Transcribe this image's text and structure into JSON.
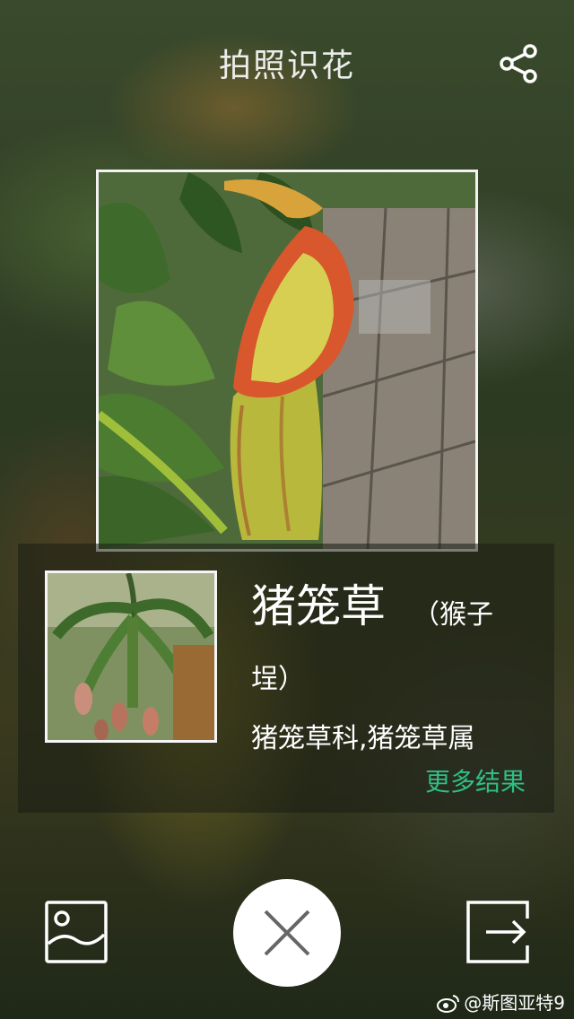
{
  "header": {
    "title": "拍照识花"
  },
  "result": {
    "name": "猪笼草",
    "alias_line1": "（猴子",
    "alias_line2": "埕）",
    "taxonomy": "猪笼草科,猪笼草属",
    "more_results_label": "更多结果"
  },
  "watermark": {
    "text": "@斯图亚特9"
  },
  "icons": {
    "share": "share-icon",
    "gallery": "image-gallery-icon",
    "close": "close-icon",
    "exit": "exit-icon",
    "weibo": "weibo-icon"
  },
  "colors": {
    "accent": "#2fbf86",
    "text": "#ffffff"
  }
}
